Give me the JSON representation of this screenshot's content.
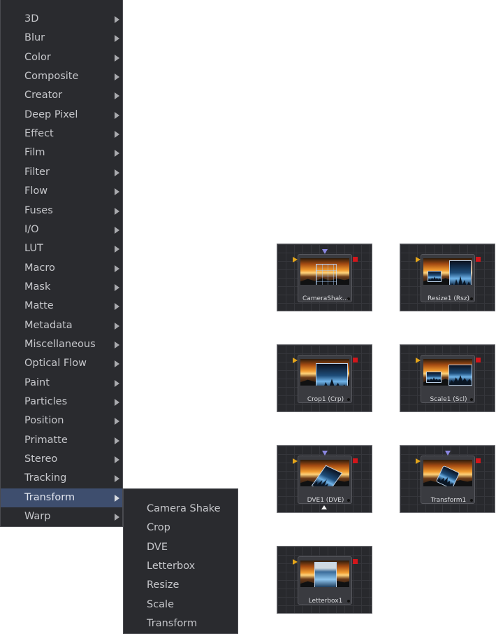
{
  "menu": {
    "items": [
      {
        "label": "3D"
      },
      {
        "label": "Blur"
      },
      {
        "label": "Color"
      },
      {
        "label": "Composite"
      },
      {
        "label": "Creator"
      },
      {
        "label": "Deep Pixel"
      },
      {
        "label": "Effect"
      },
      {
        "label": "Film"
      },
      {
        "label": "Filter"
      },
      {
        "label": "Flow"
      },
      {
        "label": "Fuses"
      },
      {
        "label": "I/O"
      },
      {
        "label": "LUT"
      },
      {
        "label": "Macro"
      },
      {
        "label": "Mask"
      },
      {
        "label": "Matte"
      },
      {
        "label": "Metadata"
      },
      {
        "label": "Miscellaneous"
      },
      {
        "label": "Optical Flow"
      },
      {
        "label": "Paint"
      },
      {
        "label": "Particles"
      },
      {
        "label": "Position"
      },
      {
        "label": "Primatte"
      },
      {
        "label": "Stereo"
      },
      {
        "label": "Tracking"
      },
      {
        "label": "Transform",
        "active": true
      },
      {
        "label": "Warp"
      }
    ]
  },
  "submenu": {
    "items": [
      "Camera Shake",
      "Crop",
      "DVE",
      "Letterbox",
      "Resize",
      "Scale",
      "Transform"
    ]
  },
  "nodes": [
    {
      "label": "CameraShak...",
      "variant": "camerashake"
    },
    {
      "label": "Resize1  (Rsz)",
      "variant": "resize"
    },
    {
      "label": "Crop1  (Crp)",
      "variant": "crop"
    },
    {
      "label": "Scale1  (Scl)",
      "variant": "scale"
    },
    {
      "label": "DVE1  (DVE)",
      "variant": "dve"
    },
    {
      "label": "Transform1",
      "variant": "transform"
    },
    {
      "label": "Letterbox1",
      "variant": "letterbox"
    }
  ],
  "colors": {
    "menu_bg": "#2a2b2f",
    "menu_highlight": "#3e4e6e",
    "input_port": "#e3a51b",
    "output_port": "#d2161b",
    "mask_port": "#8a86e0"
  }
}
